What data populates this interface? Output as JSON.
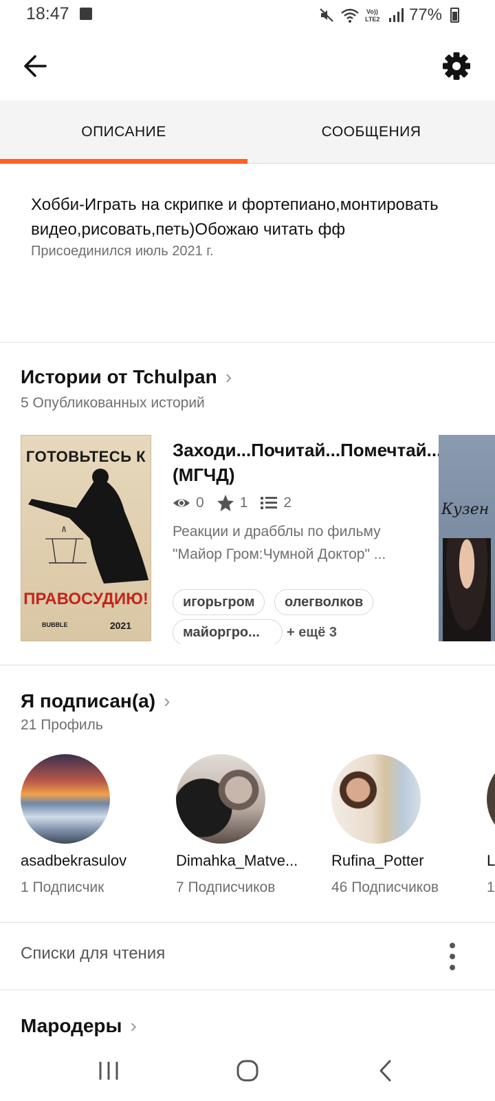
{
  "status_bar": {
    "time": "18:47",
    "battery": "77%",
    "icons": [
      "notification-check-icon",
      "mute-icon",
      "wifi-icon",
      "volte-icon",
      "signal-icon",
      "battery-icon"
    ]
  },
  "topbar": {
    "back_icon": "arrow-left-icon",
    "settings_icon": "gear-icon"
  },
  "tabs": [
    {
      "label": "ОПИСАНИЕ",
      "active": true
    },
    {
      "label": "СООБЩЕНИЯ",
      "active": false
    }
  ],
  "colors": {
    "accent": "#ff6122",
    "text_primary": "#121212",
    "text_secondary": "#6f6f6f"
  },
  "about": {
    "text": "Хобби-Играть на скрипке и фортепиано,монтировать видео,рисовать,петь)Обожаю читать фф",
    "joined": "Присоединился июль 2021 г."
  },
  "stories": {
    "title": "Истории от Tchulpan",
    "subtitle": "5 Опубликованных историй",
    "items": [
      {
        "cover_text_top": "ГОТОВЬТЕСЬ К",
        "cover_text_bottom": "ПРАВОСУДИЮ!",
        "cover_year": "2021",
        "cover_brand": "BUBBLE",
        "title": "Заходи...Почитай...Помечтай...(МГЧД)",
        "views": "0",
        "votes": "1",
        "parts": "2",
        "description": "Реакции и драбблы по фильму \"Майор Гром:Чумной Доктор\" ...",
        "tags": [
          "игорьгром",
          "олегволков",
          "майоргро..."
        ],
        "more_tags": "+ ещё 3"
      },
      {
        "cover_text": "Кузен"
      }
    ]
  },
  "following": {
    "title": "Я подписан(а)",
    "subtitle": "21 Профиль",
    "profiles": [
      {
        "name": "asadbekrasulov",
        "followers": "1 Подписчик"
      },
      {
        "name": "Dimahka_Matve...",
        "followers": "7 Подписчиков"
      },
      {
        "name": "Rufina_Potter",
        "followers": "46 Подписчиков"
      },
      {
        "name": "L",
        "followers": "1"
      }
    ]
  },
  "reading_lists": {
    "label": "Списки для чтения"
  },
  "list_section": {
    "title": "Мародеры"
  },
  "navbar": {
    "icons": [
      "recent-apps-icon",
      "home-icon",
      "back-nav-icon"
    ]
  }
}
